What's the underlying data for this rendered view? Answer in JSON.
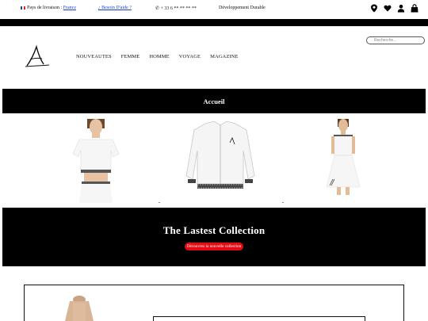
{
  "topbar": {
    "delivery_label": "Pays de livraison :",
    "delivery_country": "France",
    "help_link": "¿ Besoin D'aide ?",
    "phone": "✆ + 33 6 ** ** ** **",
    "sustainable": "Développement Durable"
  },
  "header_icons": [
    "location-pin-icon",
    "heart-icon",
    "user-icon",
    "shopping-bag-icon"
  ],
  "search": {
    "placeholder": "Recherche..."
  },
  "nav": {
    "items": [
      "NOUVEAUTES",
      "FEMME",
      "HOMME",
      "VOYAGE",
      "MAGAZINE"
    ]
  },
  "home_band": {
    "label": "Accueil"
  },
  "collection": {
    "title": "The Lastest Collection",
    "cta": "Découvrez la nouvelle collection"
  },
  "colors": {
    "accent": "#e50b14",
    "band": "#000000",
    "link": "#1a3fd8"
  }
}
